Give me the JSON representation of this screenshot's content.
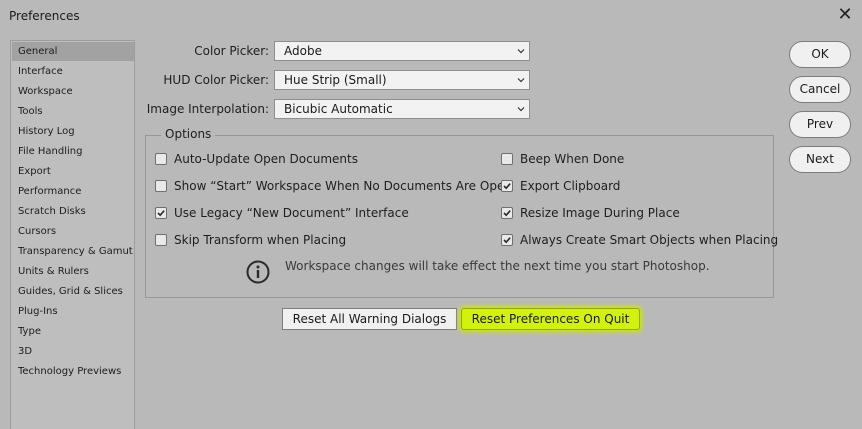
{
  "window": {
    "title": "Preferences"
  },
  "sidebar": {
    "items": [
      {
        "label": "General",
        "selected": true
      },
      {
        "label": "Interface",
        "selected": false
      },
      {
        "label": "Workspace",
        "selected": false
      },
      {
        "label": "Tools",
        "selected": false
      },
      {
        "label": "History Log",
        "selected": false
      },
      {
        "label": "File Handling",
        "selected": false
      },
      {
        "label": "Export",
        "selected": false
      },
      {
        "label": "Performance",
        "selected": false
      },
      {
        "label": "Scratch Disks",
        "selected": false
      },
      {
        "label": "Cursors",
        "selected": false
      },
      {
        "label": "Transparency & Gamut",
        "selected": false
      },
      {
        "label": "Units & Rulers",
        "selected": false
      },
      {
        "label": "Guides, Grid & Slices",
        "selected": false
      },
      {
        "label": "Plug-Ins",
        "selected": false
      },
      {
        "label": "Type",
        "selected": false
      },
      {
        "label": "3D",
        "selected": false
      },
      {
        "label": "Technology Previews",
        "selected": false
      }
    ]
  },
  "fields": {
    "color_picker": {
      "label": "Color Picker:",
      "value": "Adobe"
    },
    "hud_color_picker": {
      "label": "HUD Color Picker:",
      "value": "Hue Strip (Small)"
    },
    "image_interpolation": {
      "label": "Image Interpolation:",
      "value": "Bicubic Automatic"
    }
  },
  "options": {
    "title": "Options",
    "left": [
      {
        "label": "Auto-Update Open Documents",
        "checked": false
      },
      {
        "label": "Show “Start” Workspace When No Documents Are Open",
        "checked": false
      },
      {
        "label": "Use Legacy “New Document” Interface",
        "checked": true
      },
      {
        "label": "Skip Transform when Placing",
        "checked": false
      }
    ],
    "right": [
      {
        "label": "Beep When Done",
        "checked": false
      },
      {
        "label": "Export Clipboard",
        "checked": true
      },
      {
        "label": "Resize Image During Place",
        "checked": true
      },
      {
        "label": "Always Create Smart Objects when Placing",
        "checked": true
      }
    ],
    "info_text": "Workspace changes will take effect the next time you start Photoshop."
  },
  "buttons": {
    "reset_warnings": "Reset All Warning Dialogs",
    "reset_prefs": "Reset Preferences On Quit",
    "ok": "OK",
    "cancel": "Cancel",
    "prev": "Prev",
    "next": "Next"
  },
  "colors": {
    "dialog_bg": "#b9b9b9",
    "highlight": "#d3f20a"
  },
  "icons": {
    "close": "close-icon",
    "info": "info-icon",
    "chevron": "chevron-down-icon",
    "check": "checkmark-icon"
  }
}
